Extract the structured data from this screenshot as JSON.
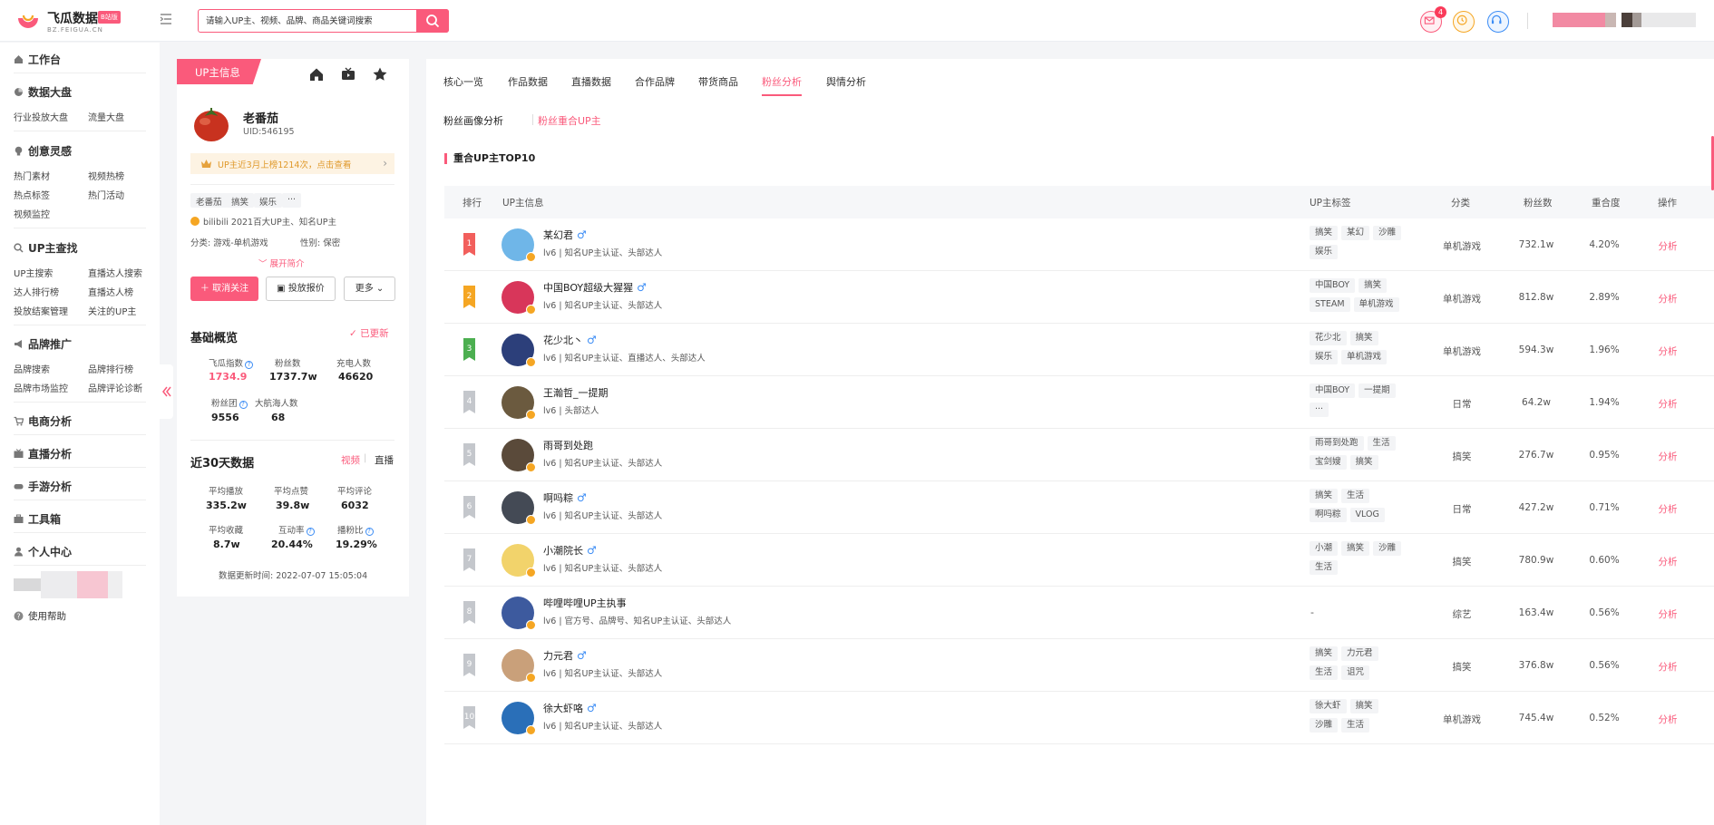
{
  "app": {
    "logo_name": "飞瓜数据",
    "logo_badge": "B站版",
    "logo_sub": "BZ.FEIGUA.CN",
    "accent": "#fa5a7b"
  },
  "search": {
    "placeholder": "请输入UP主、视频、品牌、商品关键词搜索"
  },
  "header": {
    "mail_badge": "4",
    "icons": [
      "mail-icon",
      "clock-icon",
      "headset-icon"
    ]
  },
  "sidebar": {
    "workbench": "工作台",
    "sections": [
      {
        "title": "数据大盘",
        "icon": "pie-icon",
        "items": [
          "行业投放大盘",
          "流量大盘"
        ]
      },
      {
        "title": "创意灵感",
        "icon": "bulb-icon",
        "items": [
          "热门素材",
          "视频热榜",
          "热点标签",
          "热门活动",
          "视频监控"
        ]
      },
      {
        "title": "UP主查找",
        "icon": "search-icon",
        "items": [
          "UP主搜索",
          "直播达人搜索",
          "达人排行榜",
          "直播达人榜",
          "投放结案管理",
          "关注的UP主"
        ]
      },
      {
        "title": "品牌推广",
        "icon": "megaphone-icon",
        "items": [
          "品牌搜索",
          "品牌排行榜",
          "品牌市场监控",
          "品牌评论诊断"
        ]
      }
    ],
    "singles": [
      "电商分析",
      "直播分析",
      "手游分析",
      "工具箱",
      "个人中心"
    ],
    "help": "使用帮助"
  },
  "profile": {
    "tab_label": "UP主信息",
    "name": "老番茄",
    "uid": "UID:546195",
    "notice": "UP主近3月上榜1214次，点击查看",
    "tags": [
      "老番茄",
      "搞笑",
      "娱乐",
      "···"
    ],
    "cert": "bilibili 2021百大UP主、知名UP主",
    "category": "分类: 游戏-单机游戏",
    "gender": "性别: 保密",
    "expand": "展开简介",
    "unfollow": "取消关注",
    "quote": "投放报价",
    "more": "更多",
    "basic_title": "基础概览",
    "updated": "已更新",
    "basic_stats": [
      {
        "label": "飞瓜指数",
        "value": "1734.9"
      },
      {
        "label": "粉丝数",
        "value": "1737.7w"
      },
      {
        "label": "充电人数",
        "value": "46620"
      },
      {
        "label": "粉丝团",
        "value": "9556"
      },
      {
        "label": "大航海人数",
        "value": "68"
      }
    ],
    "recent_title": "近30天数据",
    "switch_video": "视频",
    "switch_live": "直播",
    "recent_stats": [
      {
        "label": "平均播放",
        "value": "335.2w"
      },
      {
        "label": "平均点赞",
        "value": "39.8w"
      },
      {
        "label": "平均评论",
        "value": "6032"
      },
      {
        "label": "平均收藏",
        "value": "8.7w"
      },
      {
        "label": "互动率",
        "value": "20.44%"
      },
      {
        "label": "播粉比",
        "value": "19.29%"
      }
    ],
    "update_time": "数据更新时间:  2022-07-07 15:05:04"
  },
  "main": {
    "tabs": [
      "核心一览",
      "作品数据",
      "直播数据",
      "合作品牌",
      "带货商品",
      "粉丝分析",
      "舆情分析"
    ],
    "active_tab": 5,
    "subtabs": [
      "粉丝画像分析",
      "粉丝重合UP主"
    ],
    "table_title": "重合UP主TOP10",
    "columns": [
      "排行",
      "UP主信息",
      "UP主标签",
      "分类",
      "粉丝数",
      "重合度",
      "操作"
    ],
    "op_label": "分析",
    "rows": [
      {
        "rank": "1",
        "name": "某幻君",
        "male": true,
        "desc": "lv6 | 知名UP主认证、头部达人",
        "tags": [
          "搞笑",
          "某幻",
          "沙雕",
          "娱乐"
        ],
        "category": "单机游戏",
        "fans": "732.1w",
        "overlap": "4.20%"
      },
      {
        "rank": "2",
        "name": "中国BOY超级大猩猩",
        "male": true,
        "desc": "lv6 | 知名UP主认证、头部达人",
        "tags": [
          "中国BOY",
          "搞笑",
          "STEAM",
          "单机游戏"
        ],
        "category": "单机游戏",
        "fans": "812.8w",
        "overlap": "2.89%"
      },
      {
        "rank": "3",
        "name": "花少北丶",
        "male": true,
        "desc": "lv6 | 知名UP主认证、直播达人、头部达人",
        "tags": [
          "花少北",
          "搞笑",
          "娱乐",
          "单机游戏"
        ],
        "category": "单机游戏",
        "fans": "594.3w",
        "overlap": "1.96%"
      },
      {
        "rank": "4",
        "name": "王瀚哲_一提期",
        "male": false,
        "desc": "lv6 | 头部达人",
        "tags": [
          "中国BOY",
          "一提期",
          "···"
        ],
        "category": "日常",
        "fans": "64.2w",
        "overlap": "1.94%"
      },
      {
        "rank": "5",
        "name": "雨哥到处跑",
        "male": false,
        "desc": "lv6 | 知名UP主认证、头部达人",
        "tags": [
          "雨哥到处跑",
          "生活",
          "宝剑嫂",
          "搞笑"
        ],
        "category": "搞笑",
        "fans": "276.7w",
        "overlap": "0.95%"
      },
      {
        "rank": "6",
        "name": "啊吗粽",
        "male": true,
        "desc": "lv6 | 知名UP主认证、头部达人",
        "tags": [
          "搞笑",
          "生活",
          "啊吗粽",
          "VLOG"
        ],
        "category": "日常",
        "fans": "427.2w",
        "overlap": "0.71%"
      },
      {
        "rank": "7",
        "name": "小潮院长",
        "male": true,
        "desc": "lv6 | 知名UP主认证、头部达人",
        "tags": [
          "小潮",
          "搞笑",
          "沙雕",
          "生活"
        ],
        "category": "搞笑",
        "fans": "780.9w",
        "overlap": "0.60%"
      },
      {
        "rank": "8",
        "name": "哔哩哔哩UP主执事",
        "male": false,
        "desc": "lv6 | 官方号、品牌号、知名UP主认证、头部达人",
        "tags": [],
        "category": "综艺",
        "fans": "163.4w",
        "overlap": "0.56%"
      },
      {
        "rank": "9",
        "name": "力元君",
        "male": true,
        "desc": "lv6 | 知名UP主认证、头部达人",
        "tags": [
          "搞笑",
          "力元君",
          "生活",
          "诅咒"
        ],
        "category": "搞笑",
        "fans": "376.8w",
        "overlap": "0.56%"
      },
      {
        "rank": "10",
        "name": "徐大虾咯",
        "male": true,
        "desc": "lv6 | 知名UP主认证、头部达人",
        "tags": [
          "徐大虾",
          "搞笑",
          "沙雕",
          "生活"
        ],
        "category": "单机游戏",
        "fans": "745.4w",
        "overlap": "0.52%"
      }
    ],
    "empty_tags": "-"
  }
}
